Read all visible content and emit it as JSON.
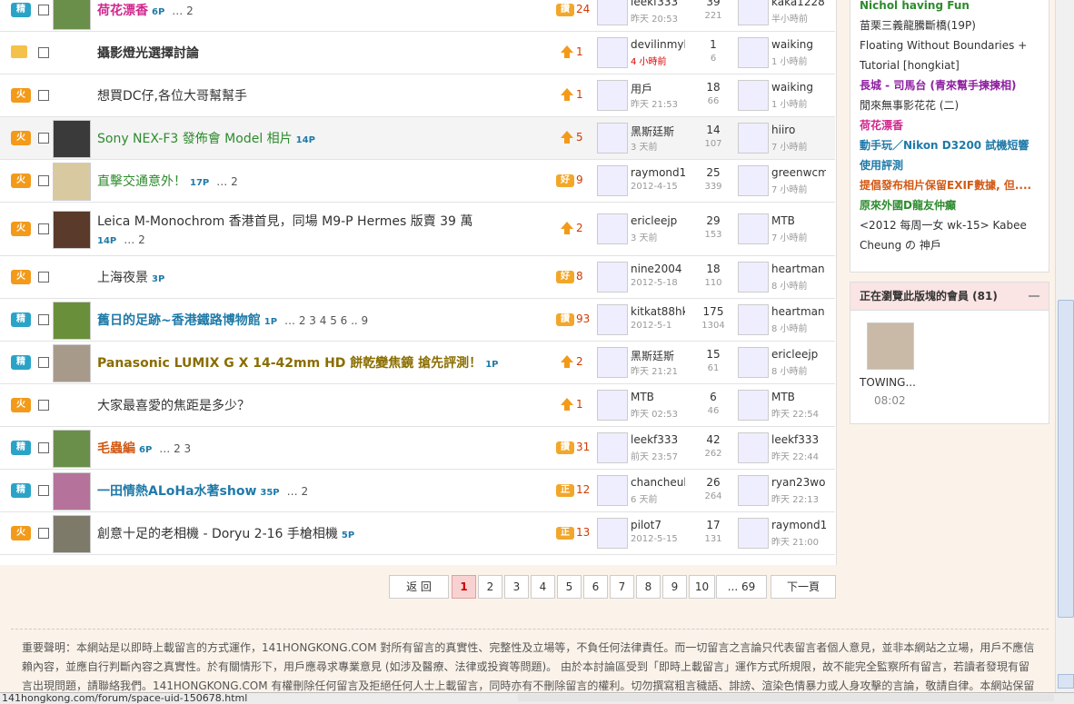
{
  "threads": [
    {
      "tag": "精",
      "title": "荷花漂香",
      "title_class": "pink",
      "pc": "6P",
      "pages": "… 2",
      "ricon": "badge",
      "ricon_text": "讚",
      "rnum": "24",
      "u1": "leekf333",
      "t1": "昨天 20:53",
      "cnt": "39",
      "views": "221",
      "u2": "kaka1228",
      "t2": "半小時前"
    },
    {
      "tag": "folder",
      "title": "攝影燈光選擇討論",
      "title_class": "bold",
      "pc": "",
      "pages": "",
      "ricon": "up",
      "rnum": "1",
      "u1": "devilinmyhe",
      "t1": "4 小時前",
      "t1_red": true,
      "cnt": "1",
      "views": "6",
      "u2": "waiking",
      "t2": "1 小時前"
    },
    {
      "tag": "火",
      "title": "想買DC仔,各位大哥幫幫手",
      "title_class": "",
      "pc": "",
      "pages": "",
      "ricon": "up",
      "rnum": "1",
      "u1": "用戶",
      "t1": "昨天 21:53",
      "cnt": "18",
      "views": "66",
      "u2": "waiking",
      "t2": "1 小時前"
    },
    {
      "tag": "火",
      "title": "Sony NEX-F3 發佈會 Model 相片",
      "title_class": "green",
      "pc": "14P",
      "pages": "",
      "ricon": "up",
      "rnum": "5",
      "u1": "黑斯廷斯",
      "t1": "3 天前",
      "cnt": "14",
      "views": "107",
      "u2": "hiiro",
      "t2": "7 小時前",
      "hl": true
    },
    {
      "tag": "火",
      "title": "直擊交通意外！",
      "title_class": "green",
      "pc": "17P",
      "pages": "… 2",
      "ricon": "badge",
      "ricon_text": "好",
      "rnum": "9",
      "u1": "raymond16",
      "t1": "2012-4-15",
      "cnt": "25",
      "views": "339",
      "u2": "greenwcm",
      "t2": "7 小時前"
    },
    {
      "tag": "火",
      "title": "Leica M-Monochrom 香港首見，同場 M9-P Hermes 版賣 39 萬",
      "title_class": "",
      "pc": "14P",
      "pages": "… 2",
      "two_line": true,
      "ricon": "up",
      "rnum": "2",
      "u1": "ericleejp",
      "t1": "3 天前",
      "cnt": "29",
      "views": "153",
      "u2": "MTB",
      "t2": "7 小時前"
    },
    {
      "tag": "火",
      "title": "上海夜景",
      "title_class": "",
      "pc": "3P",
      "pages": "",
      "ricon": "badge",
      "ricon_text": "好",
      "rnum": "8",
      "u1": "nine2004",
      "t1": "2012-5-18",
      "cnt": "18",
      "views": "110",
      "u2": "heartman",
      "t2": "8 小時前"
    },
    {
      "tag": "精",
      "title": "舊日的足跡~香港鐵路博物館",
      "title_class": "blue",
      "pc": "1P",
      "pages": "… 2 3 4 5 6 .. 9",
      "ricon": "badge",
      "ricon_text": "讚",
      "rnum": "93",
      "u1": "kitkat88hk",
      "t1": "2012-5-1",
      "cnt": "175",
      "views": "1304",
      "u2": "heartman",
      "t2": "8 小時前"
    },
    {
      "tag": "精",
      "title": "Panasonic LUMIX G X 14-42mm HD 餅乾變焦鏡 搶先評測！",
      "title_class": "gold",
      "pc": "1P",
      "pages": "",
      "ricon": "up",
      "rnum": "2",
      "u1": "黑斯廷斯",
      "t1": "昨天 21:21",
      "cnt": "15",
      "views": "61",
      "u2": "ericleejp",
      "t2": "8 小時前"
    },
    {
      "tag": "火",
      "title": "大家最喜愛的焦距是多少？",
      "title_class": "",
      "pc": "",
      "pages": "",
      "ricon": "up",
      "rnum": "1",
      "u1": "MTB",
      "t1": "昨天 02:53",
      "cnt": "6",
      "views": "46",
      "u2": "MTB",
      "t2": "昨天 22:54"
    },
    {
      "tag": "精",
      "title": "毛蟲編",
      "title_class": "orange",
      "pc": "6P",
      "pages": "… 2 3",
      "ricon": "badge",
      "ricon_text": "讚",
      "rnum": "31",
      "u1": "leekf333",
      "t1": "前天 23:57",
      "cnt": "42",
      "views": "262",
      "u2": "leekf333",
      "t2": "昨天 22:44"
    },
    {
      "tag": "精",
      "title": "一田情熱ALoHa水著show",
      "title_class": "blue",
      "pc": "35P",
      "pages": "… 2",
      "ricon": "badge",
      "ricon_text": "正",
      "rnum": "12",
      "u1": "chancheuk",
      "t1": "6 天前",
      "cnt": "26",
      "views": "264",
      "u2": "ryan23wor",
      "t2": "昨天 22:13"
    },
    {
      "tag": "火",
      "title": "創意十足的老相機 - Doryu 2-16 手槍相機",
      "title_class": "",
      "pc": "5P",
      "pages": "",
      "ricon": "badge",
      "ricon_text": "正",
      "rnum": "13",
      "u1": "pilot7",
      "t1": "2012-5-15",
      "cnt": "17",
      "views": "131",
      "u2": "raymond16",
      "t2": "昨天 21:00"
    }
  ],
  "pagination": {
    "back": "返 回",
    "pages": [
      "1",
      "2",
      "3",
      "4",
      "5",
      "6",
      "7",
      "8",
      "9",
      "10",
      "... 69"
    ],
    "next": "下一頁"
  },
  "sidebar": {
    "links": [
      {
        "text": "Nichol having Fun",
        "cls": "green"
      },
      {
        "text": "苗栗三義龍騰斷橋(19P)",
        "cls": "plain"
      },
      {
        "text": "Floating Without Boundaries +",
        "cls": "plain"
      },
      {
        "text": "Tutorial [hongkiat]",
        "cls": "plain"
      },
      {
        "text": "長城 - 司馬台 (青來幫手揀揀相)",
        "cls": "purple"
      },
      {
        "text": "閒來無事影花花 (二)",
        "cls": "plain"
      },
      {
        "text": "荷花漂香",
        "cls": "pink"
      },
      {
        "text": "動手玩／Nikon D3200 試機短響",
        "cls": "blue"
      },
      {
        "text": "使用評測",
        "cls": "blue"
      },
      {
        "text": "提倡發布相片保留EXIF數據, 但....",
        "cls": "orange"
      },
      {
        "text": "原來外國D龍友仲癲",
        "cls": "green"
      },
      {
        "text": "<2012 每周一女 wk-15> Kabee",
        "cls": "plain"
      },
      {
        "text": "Cheung の 神戶",
        "cls": "plain"
      }
    ],
    "online_title": "正在瀏覽此版塊的會員 (81)",
    "online_user": "TOWING...",
    "online_time": "08:02"
  },
  "disclaimer": "重要聲明：本網站是以即時上載留言的方式運作，141HONGKONG.COM 對所有留言的真實性、完整性及立場等，不負任何法律責任。而一切留言之言論只代表留言者個人意見，並非本網站之立場，用戶不應信賴內容，並應自行判斷內容之真實性。於有關情形下，用戶應尋求專業意見 (如涉及醫療、法律或投資等問題)。 由於本討論區受到「即時上載留言」運作方式所規限，故不能完全監察所有留言，若讀者發現有留言出現問題，請聯絡我們。141HONGKONG.COM 有權刪除任何留言及拒絕任何人士上載留言，同時亦有不刪除留言的權利。切勿撰寫粗言穢語、誹謗、渲染色情暴力或人身攻擊的言論，敬請自律。本網站保留一切",
  "status_url": "141hongkong.com/forum/space-uid-150678.html",
  "colors": {
    "accent_orange": "#f39a1a",
    "accent_blue": "#2aa3c8",
    "current_page_bg": "#f8d2d2"
  }
}
